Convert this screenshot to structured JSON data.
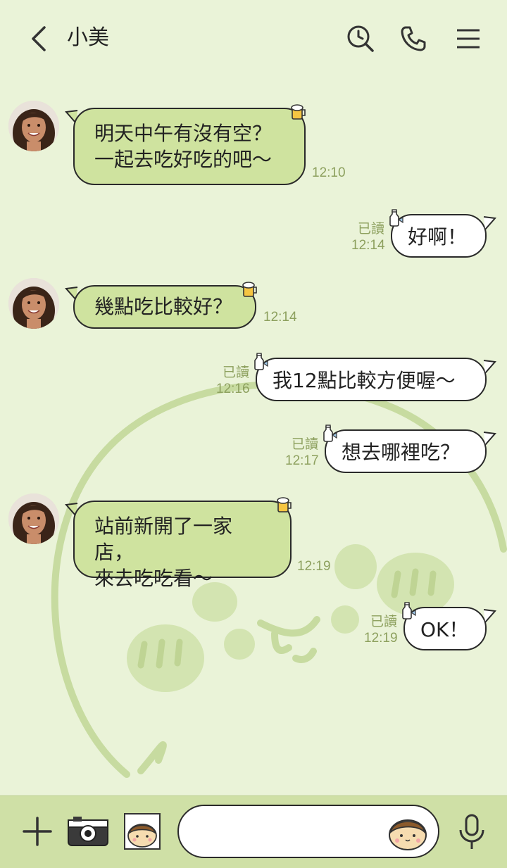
{
  "header": {
    "title": "小美"
  },
  "messages": [
    {
      "text_lines": [
        "明天中午有沒有空？",
        "一起去吃好吃的吧～"
      ],
      "time": "12:10"
    },
    {
      "text": "好啊！",
      "read": "已讀",
      "time": "12:14"
    },
    {
      "text": "幾點吃比較好？",
      "time": "12:14"
    },
    {
      "text": "我12點比較方便喔～",
      "read": "已讀",
      "time": "12:16"
    },
    {
      "text": "想去哪裡吃？",
      "read": "已讀",
      "time": "12:17"
    },
    {
      "text_lines": [
        "站前新開了一家店，",
        "來去吃吃看～"
      ],
      "time": "12:19"
    },
    {
      "text": "OK！",
      "read": "已讀",
      "time": "12:19"
    }
  ],
  "colors": {
    "background": "#eaf3d8",
    "incoming_bubble": "#cfe39f",
    "outgoing_bubble": "#ffffff",
    "meta_text": "#8da05e",
    "bottom_bar": "#cfe0a6"
  },
  "icons": [
    "back-icon",
    "clock-search-icon",
    "phone-icon",
    "menu-icon",
    "plus-icon",
    "camera-icon",
    "sticker-icon",
    "emoji-icon",
    "microphone-icon"
  ]
}
